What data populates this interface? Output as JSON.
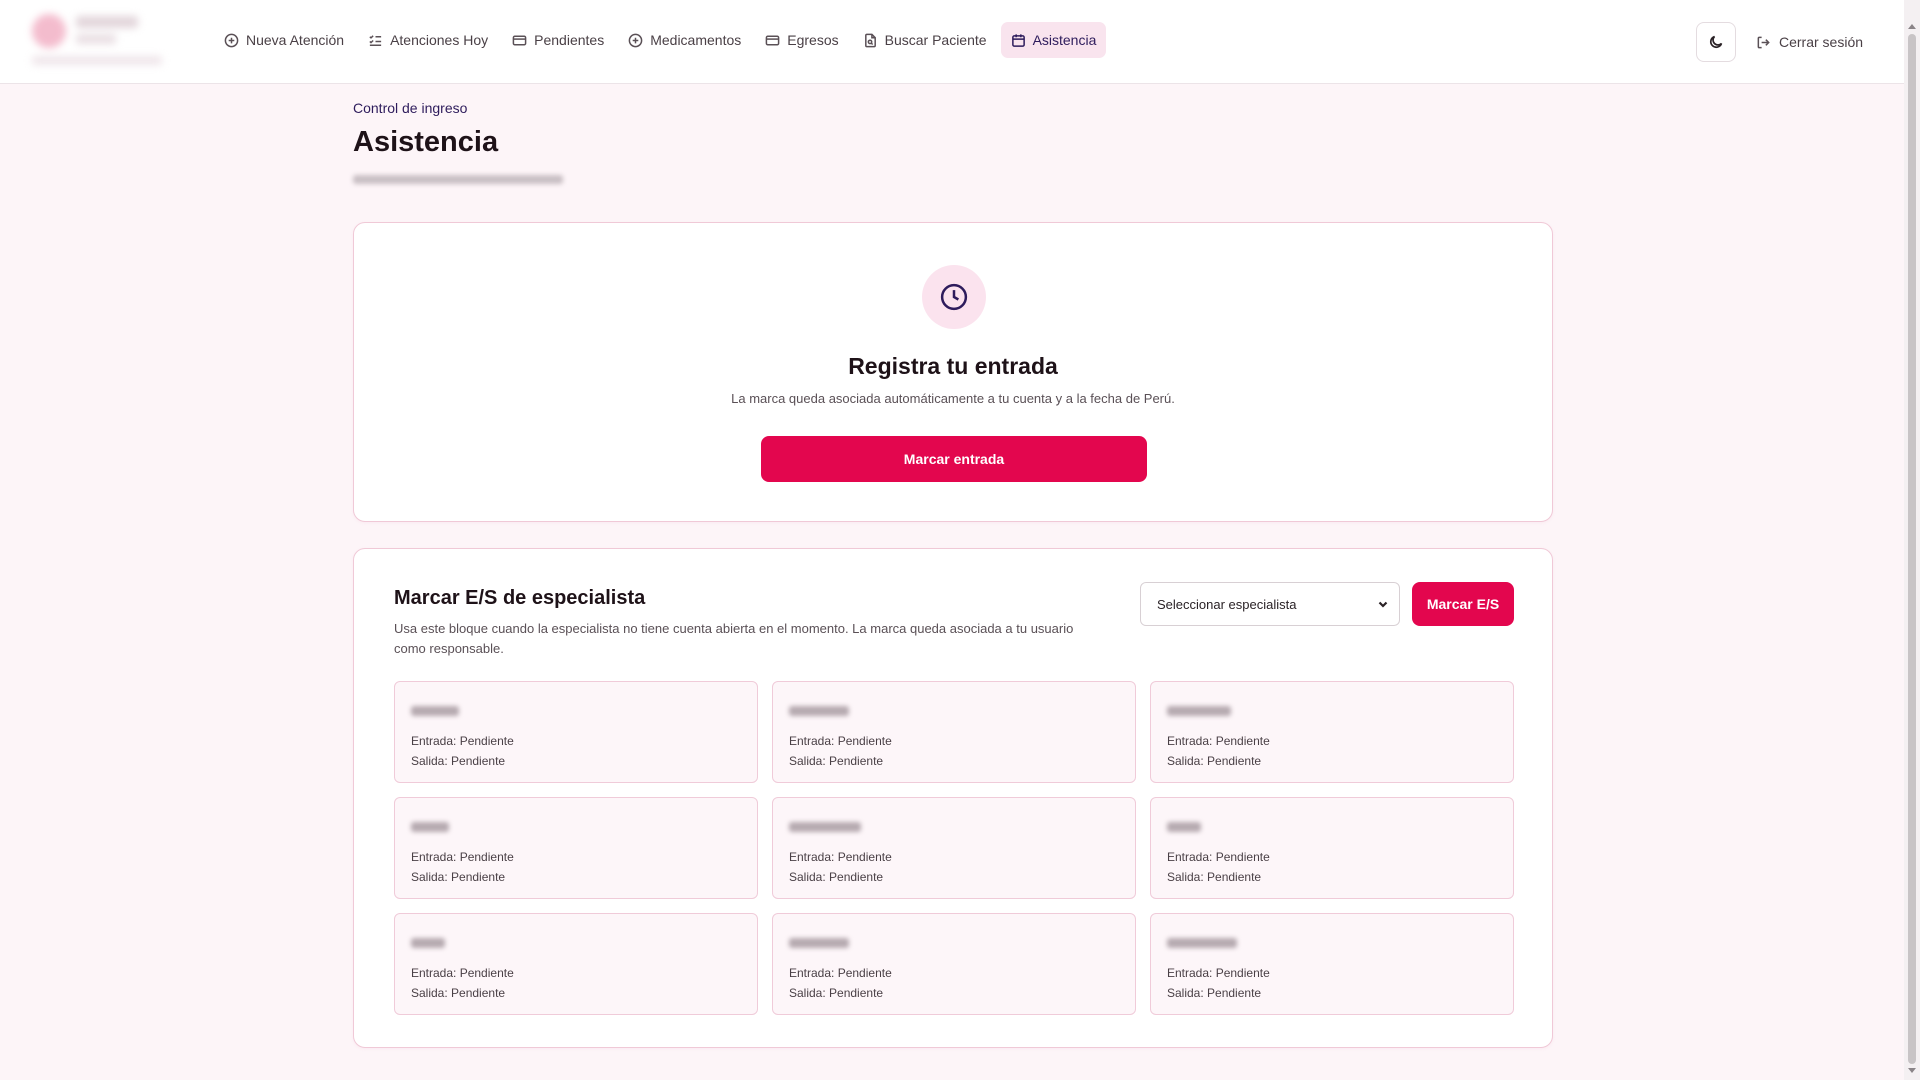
{
  "header": {
    "logo_alt": "",
    "nav": [
      {
        "label": "Nueva Atención",
        "icon": "plus-circle-icon",
        "active": false
      },
      {
        "label": "Atenciones Hoy",
        "icon": "list-checks-icon",
        "active": false
      },
      {
        "label": "Pendientes",
        "icon": "card-icon",
        "active": false
      },
      {
        "label": "Medicamentos",
        "icon": "plus-circle-icon",
        "active": false
      },
      {
        "label": "Egresos",
        "icon": "card-icon",
        "active": false
      },
      {
        "label": "Buscar Paciente",
        "icon": "file-search-icon",
        "active": false
      },
      {
        "label": "Asistencia",
        "icon": "calendar-icon",
        "active": true
      }
    ],
    "theme_toggle_icon": "moon-icon",
    "logout_label": "Cerrar sesión",
    "logout_icon": "logout-icon"
  },
  "page": {
    "eyebrow": "Control de ingreso",
    "title": "Asistencia"
  },
  "entry_card": {
    "icon": "clock-icon",
    "title": "Registra tu entrada",
    "description": "La marca queda asociada automáticamente a tu cuenta y a la fecha de Perú.",
    "button_label": "Marcar entrada"
  },
  "specialist_card": {
    "title": "Marcar E/S de especialista",
    "description": "Usa este bloque cuando la especialista no tiene cuenta abierta en el momento. La marca queda asociada a tu usuario como responsable.",
    "select_value": "Seleccionar especialista",
    "button_label": "Marcar E/S",
    "specialists": [
      {
        "entry": "Entrada: Pendiente",
        "exit": "Salida: Pendiente"
      },
      {
        "entry": "Entrada: Pendiente",
        "exit": "Salida: Pendiente"
      },
      {
        "entry": "Entrada: Pendiente",
        "exit": "Salida: Pendiente"
      },
      {
        "entry": "Entrada: Pendiente",
        "exit": "Salida: Pendiente"
      },
      {
        "entry": "Entrada: Pendiente",
        "exit": "Salida: Pendiente"
      },
      {
        "entry": "Entrada: Pendiente",
        "exit": "Salida: Pendiente"
      },
      {
        "entry": "Entrada: Pendiente",
        "exit": "Salida: Pendiente"
      },
      {
        "entry": "Entrada: Pendiente",
        "exit": "Salida: Pendiente"
      },
      {
        "entry": "Entrada: Pendiente",
        "exit": "Salida: Pendiente"
      }
    ]
  },
  "colors": {
    "accent": "#e3064e",
    "brand_dark": "#2e1c5c",
    "active_tab_bg": "#f9e4ee",
    "card_border": "#f0c9d7",
    "page_bg": "#fdf5f8"
  }
}
